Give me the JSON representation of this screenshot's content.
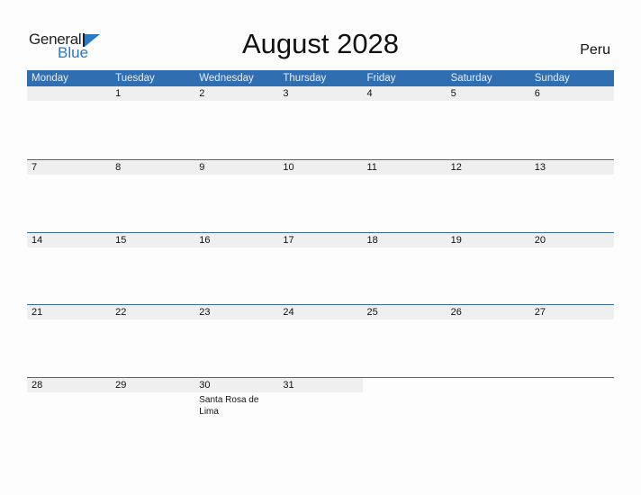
{
  "logo": {
    "general": "General",
    "blue": "Blue"
  },
  "header": {
    "title": "August 2028",
    "country": "Peru"
  },
  "colors": {
    "accent": "#2f6fb1",
    "strip": "#efefef",
    "logo_blue": "#2b78c2"
  },
  "days": [
    "Monday",
    "Tuesday",
    "Wednesday",
    "Thursday",
    "Friday",
    "Saturday",
    "Sunday"
  ],
  "weeks": [
    [
      "",
      "1",
      "2",
      "3",
      "4",
      "5",
      "6"
    ],
    [
      "7",
      "8",
      "9",
      "10",
      "11",
      "12",
      "13"
    ],
    [
      "14",
      "15",
      "16",
      "17",
      "18",
      "19",
      "20"
    ],
    [
      "21",
      "22",
      "23",
      "24",
      "25",
      "26",
      "27"
    ],
    [
      "28",
      "29",
      "30",
      "31",
      "",
      "",
      ""
    ]
  ],
  "holidays": [
    {
      "week": 4,
      "day": 2,
      "label": "Santa Rosa de Lima"
    }
  ]
}
